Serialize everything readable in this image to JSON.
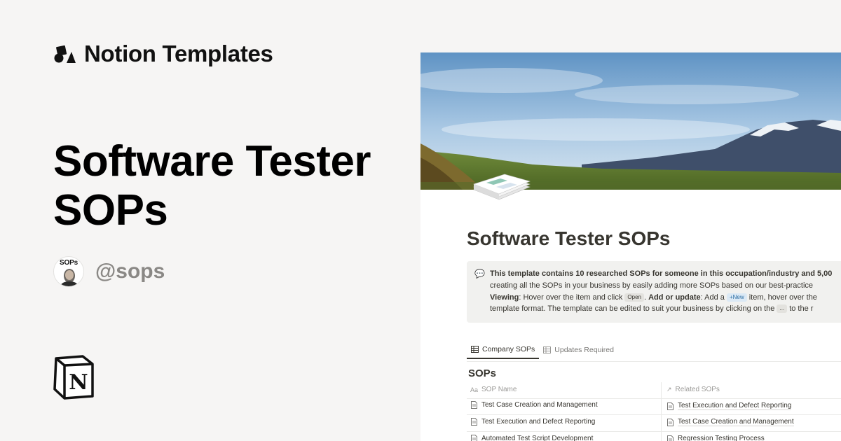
{
  "brand": {
    "name": "Notion Templates",
    "icon": "shapes-logo-icon"
  },
  "hero": {
    "title": "Software Tester SOPs"
  },
  "author": {
    "avatar_label": "SOPs",
    "handle": "@sops"
  },
  "notion_logo": {
    "letter": "N"
  },
  "preview": {
    "page_title": "Software Tester SOPs",
    "callout": {
      "icon": "💬",
      "line1": "This template contains 10 researched SOPs for someone in this occupation/industry and 5,00",
      "line2": "creating all the SOPs in your business by easily adding more SOPs based on our best-practice",
      "line3_bold_a": "Viewing",
      "line3_a": ": Hover over the item and click ",
      "chip_open": "Open",
      "line3_b": ". ",
      "line3_bold_b": "Add or update",
      "line3_c": ": Add a ",
      "chip_new": "+New",
      "line3_d": " item, hover over the",
      "line4_a": "template format. The template can be edited to suit your business by clicking on the ",
      "chip_dots": "...",
      "line4_b": " to the r"
    },
    "tabs": [
      {
        "label": "Company SOPs",
        "active": true
      },
      {
        "label": "Updates Required",
        "active": false
      }
    ],
    "database_title": "SOPs",
    "columns": {
      "name": "SOP Name",
      "name_icon": "Aa",
      "related": "Related SOPs",
      "related_icon": "↗"
    },
    "rows": [
      {
        "name": "Test Case Creation and Management",
        "related": "Test Execution and Defect Reporting"
      },
      {
        "name": "Test Execution and Defect Reporting",
        "related": "Test Case Creation and Management"
      },
      {
        "name": "Automated Test Script Development",
        "related": "Regression Testing Process"
      }
    ]
  }
}
